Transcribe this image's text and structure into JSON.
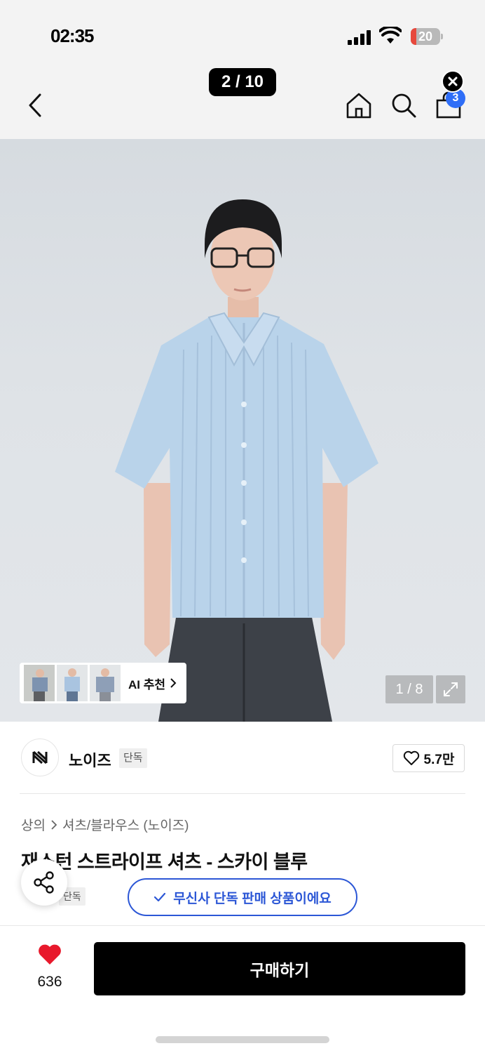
{
  "status_bar": {
    "time": "02:35",
    "battery_level": "20",
    "battery_fraction": 0.2
  },
  "nav": {
    "page_counter": "2 / 10",
    "cart_count": "3"
  },
  "product_image": {
    "ai_recommend_label": "AI 추천",
    "image_counter": "1 / 8"
  },
  "brand": {
    "name": "노이즈",
    "exclusive_tag": "단독",
    "likes": "5.7만"
  },
  "product": {
    "breadcrumb": [
      "상의",
      "셔츠/블라우스 (노이즈)"
    ],
    "title": "재스턴 스트라이프 셔츠 - 스카이 블루",
    "small_tag": "단독",
    "exclusive_pill": "무신사 단독 판매 상품이에요"
  },
  "bottom_bar": {
    "wishlist_count": "636",
    "buy_label": "구매하기"
  },
  "colors": {
    "accent_blue": "#2c57d6",
    "badge_blue": "#2f6ef7",
    "heart_red": "#e8192c",
    "shirt_blue": "#b9d3ea",
    "background_grey": "#f3f3f3"
  },
  "icons": {
    "back": "chevron-left-icon",
    "home": "home-icon",
    "search": "search-icon",
    "cart": "shopping-bag-icon",
    "close": "close-icon",
    "fullscreen": "expand-icon",
    "like": "heart-outline-icon",
    "wishlist": "heart-filled-icon",
    "share": "share-icon",
    "check": "check-icon"
  }
}
